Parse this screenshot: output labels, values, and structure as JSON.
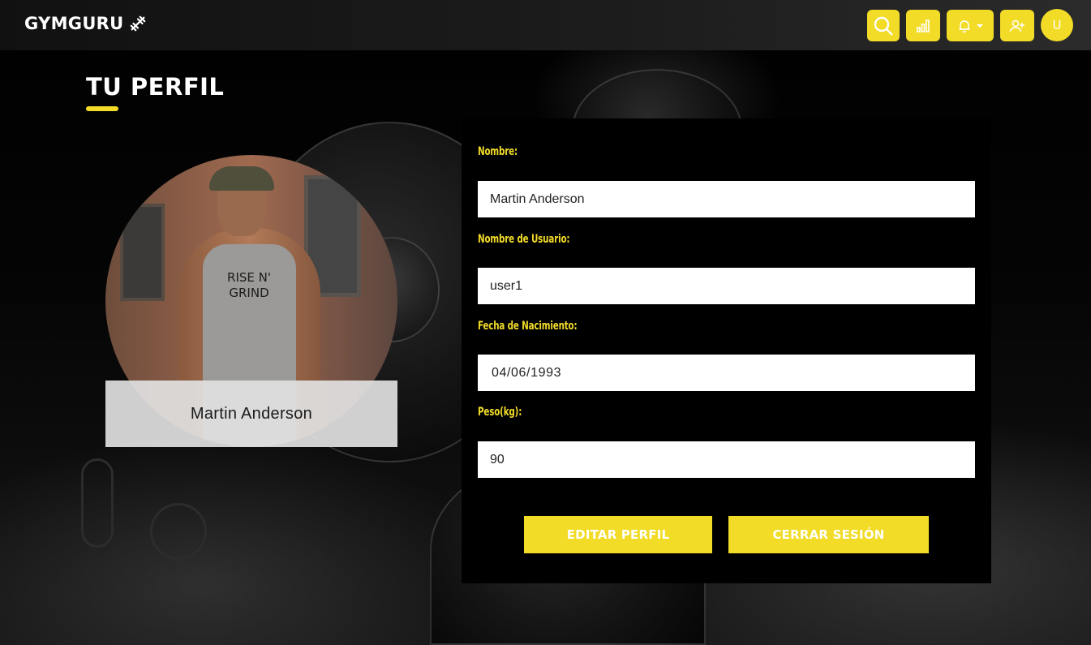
{
  "navbar": {
    "brand": "GYMGURU",
    "buttons": [
      {
        "name": "search-button",
        "icon": "search-icon"
      },
      {
        "name": "stats-button",
        "icon": "bar-chart-icon"
      },
      {
        "name": "notifications-button",
        "icon": "bell-icon"
      },
      {
        "name": "add-user-button",
        "icon": "user-plus-icon"
      }
    ],
    "avatar_initial": "U"
  },
  "page": {
    "title": "TU PERFIL"
  },
  "profile": {
    "display_name": "Martin Anderson",
    "photo_shirt_text": "RISE N' GRIND"
  },
  "form": {
    "fields": [
      {
        "label": "Nombre:",
        "value": "Martin Anderson"
      },
      {
        "label": "Nombre de Usuario:",
        "value": "user1"
      },
      {
        "label": "Fecha de Nacimiento:",
        "value": "04/06/1993"
      },
      {
        "label": "Peso(kg):",
        "value": "90"
      }
    ],
    "edit_label": "EDITAR PERFIL",
    "logout_label": "CERRAR SESIÓN"
  },
  "colors": {
    "accent": "#f2dc28",
    "background": "#000000",
    "caption_bg": "#e1e1e1"
  }
}
